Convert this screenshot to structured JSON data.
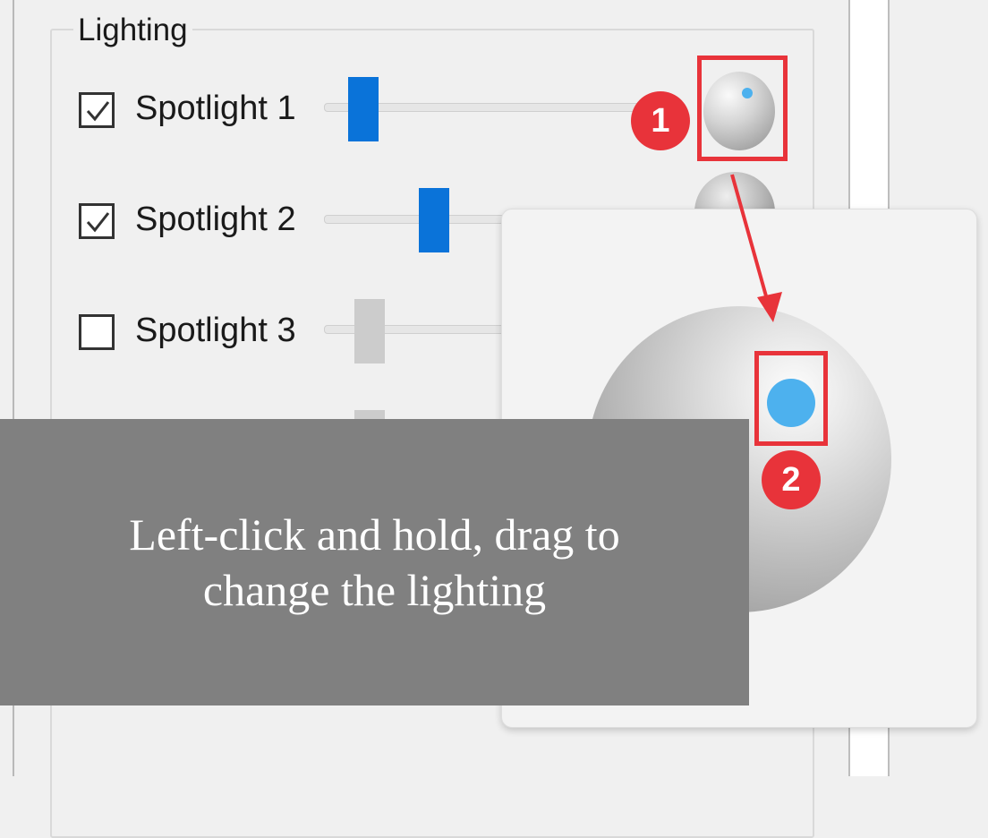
{
  "groupbox": {
    "title": "Lighting"
  },
  "spotlights": [
    {
      "label": "Spotlight 1",
      "checked": true,
      "enabled": true,
      "intensity": 0.12
    },
    {
      "label": "Spotlight 2",
      "checked": true,
      "enabled": true,
      "intensity": 0.3
    },
    {
      "label": "Spotlight 3",
      "checked": false,
      "enabled": false,
      "intensity": 0.1
    },
    {
      "label": "",
      "checked": false,
      "enabled": false,
      "intensity": 0.1
    }
  ],
  "annotations": {
    "badge1": "1",
    "badge2": "2",
    "accent": "#e8333a"
  },
  "tooltip": {
    "line1": "Left-click and hold, drag to",
    "line2": "change the lighting"
  },
  "colors": {
    "slider_thumb": "#0a73d9",
    "light_dot": "#4db1ee"
  }
}
